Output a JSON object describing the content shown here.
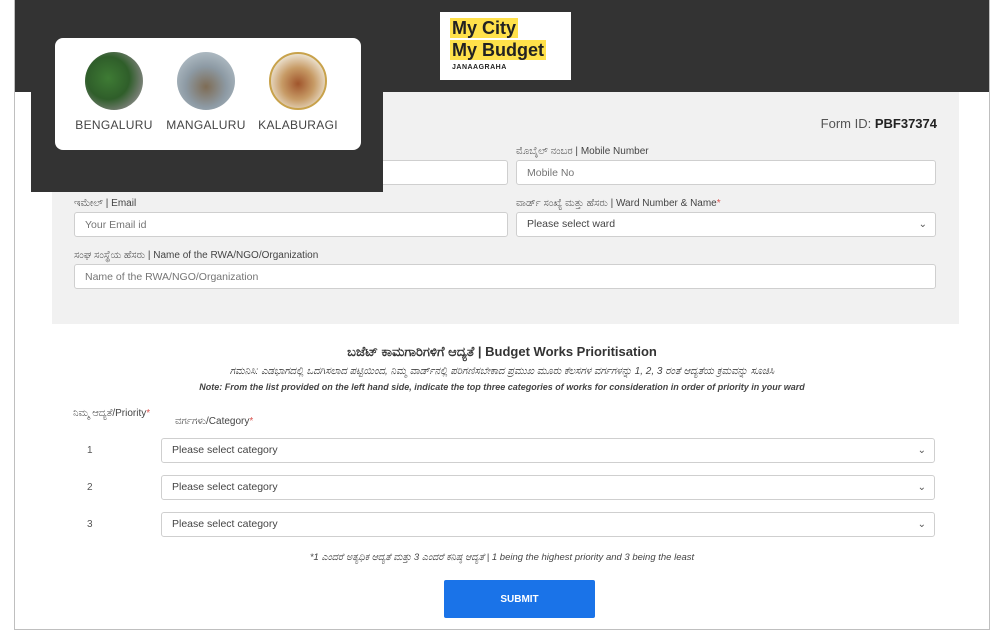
{
  "brand": {
    "line1": "My City",
    "line2": "My Budget",
    "sub": "JANAAGRAHA"
  },
  "cities": [
    {
      "name": "BENGALURU"
    },
    {
      "name": "MANGALURU"
    },
    {
      "name": "KALABURAGI"
    }
  ],
  "form": {
    "form_id_label": "Form ID:",
    "form_id_value": "PBF37374",
    "mobile_label": "ಮೊಬೈಲ್ ನಂಬರ | Mobile Number",
    "mobile_placeholder": "Mobile No",
    "email_label": "ಇಮೇಲ್ | Email",
    "email_placeholder": "Your Email id",
    "ward_label": "ವಾರ್ಡ್ ಸಂಖ್ಯೆ ಮತ್ತು ಹೆಸರು | Ward Number & Name",
    "ward_value": "Please select ward",
    "org_label": "ಸಂಘ ಸಂಸ್ಥೆಯ ಹೆಸರು | Name of the RWA/NGO/Organization",
    "org_placeholder": "Name of the RWA/NGO/Organization"
  },
  "prioritisation": {
    "title": "ಬಜೆಟ್ ಕಾಮಗಾರಿಗಳಿಗೆ ಆದ್ಯತೆ | Budget Works Prioritisation",
    "note_kn": "ಗಮನಿಸಿ: ಎಡಭಾಗದಲ್ಲಿ ಒದಗಿಸಲಾದ ಪಟ್ಟಿಯಿಂದ, ನಿಮ್ಮ ವಾರ್ಡ್‌ನಲ್ಲಿ ಪರಿಗಣಿಸಬೇಕಾದ ಪ್ರಮುಖ ಮೂರು ಕೆಲಸಗಳ ವರ್ಗಗಳನ್ನು 1, 2, 3 ರಂತೆ ಆದ್ಯತೆಯ ಕ್ರಮವನ್ನು ಸೂಚಿಸಿ",
    "note_en": "Note: From the list provided on the left hand side, indicate the top three categories of works for consideration in order of priority in your ward",
    "priority_header": "ನಿಮ್ಮ ಆದ್ಯತೆ/Priority",
    "category_header": "ವರ್ಗಗಳು/Category",
    "rows": [
      {
        "num": "1",
        "value": "Please select category"
      },
      {
        "num": "2",
        "value": "Please select category"
      },
      {
        "num": "3",
        "value": "Please select category"
      }
    ],
    "footnote": "*1 ಎಂದರೆ ಅತ್ಯಧಿಕ ಆದ್ಯತೆ ಮತ್ತು 3 ಎಂದರೆ ಕನಿಷ್ಠ ಆದ್ಯತೆ | 1 being the highest priority and 3 being the least",
    "submit_label": "SUBMIT"
  }
}
